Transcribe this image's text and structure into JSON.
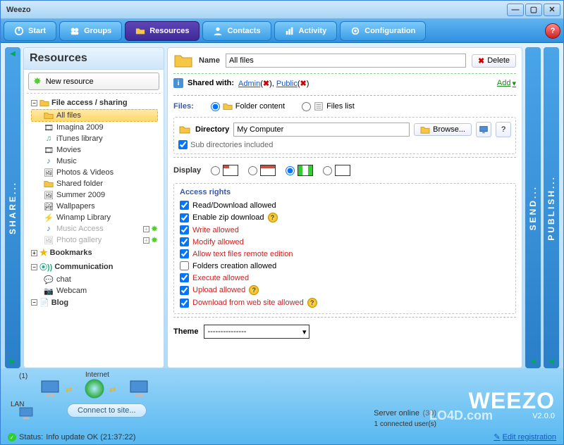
{
  "window": {
    "title": "Weezo"
  },
  "toolbar": {
    "tabs": [
      {
        "label": "Start",
        "icon": "power-icon"
      },
      {
        "label": "Groups",
        "icon": "groups-icon"
      },
      {
        "label": "Resources",
        "icon": "folder-icon",
        "active": true
      },
      {
        "label": "Contacts",
        "icon": "contacts-icon"
      },
      {
        "label": "Activity",
        "icon": "activity-icon"
      },
      {
        "label": "Configuration",
        "icon": "gear-icon"
      }
    ]
  },
  "side": {
    "left": "SHARE...",
    "right1": "SEND...",
    "right2": "PUBLISH..."
  },
  "left": {
    "header": "Resources",
    "new_btn": "New resource",
    "groups": {
      "file_sharing": {
        "label": "File access / sharing",
        "expanded": true,
        "items": [
          {
            "label": "All files",
            "icon": "folder-icon",
            "selected": true
          },
          {
            "label": "Imagina 2009",
            "icon": "film-icon"
          },
          {
            "label": "iTunes library",
            "icon": "itunes-icon"
          },
          {
            "label": "Movies",
            "icon": "film-icon"
          },
          {
            "label": "Music",
            "icon": "music-icon"
          },
          {
            "label": "Photos & Videos",
            "icon": "photo-icon"
          },
          {
            "label": "Shared folder",
            "icon": "folder-icon"
          },
          {
            "label": "Summer 2009",
            "icon": "photo-icon"
          },
          {
            "label": "Wallpapers",
            "icon": "picture-icon"
          },
          {
            "label": "Winamp Library",
            "icon": "winamp-icon"
          },
          {
            "label": "Music Access",
            "icon": "music-icon",
            "disabled": true,
            "extra": true
          },
          {
            "label": "Photo gallery",
            "icon": "photo-icon",
            "disabled": true,
            "extra": true
          }
        ]
      },
      "bookmarks": {
        "label": "Bookmarks",
        "expanded": false
      },
      "communication": {
        "label": "Communication",
        "expanded": true,
        "items": [
          {
            "label": "chat",
            "icon": "chat-icon"
          },
          {
            "label": "Webcam",
            "icon": "webcam-icon"
          }
        ]
      },
      "blog": {
        "label": "Blog",
        "expanded": true
      }
    }
  },
  "right": {
    "name_label": "Name",
    "name_value": "All files",
    "delete_label": "Delete",
    "shared_label": "Shared with:",
    "shared_users": [
      "Admin",
      "Public"
    ],
    "add_label": "Add",
    "files_label": "Files:",
    "folder_content_label": "Folder content",
    "files_list_label": "Files list",
    "files_mode": "folder_content",
    "directory_label": "Directory",
    "directory_value": "My Computer",
    "browse_label": "Browse...",
    "subdir_label": "Sub directories included",
    "subdir_checked": true,
    "display_label": "Display",
    "display_selected": 2,
    "access_title": "Access rights",
    "rights": [
      {
        "label": "Read/Download allowed",
        "checked": true,
        "red": false,
        "help": false
      },
      {
        "label": "Enable zip download",
        "checked": true,
        "red": false,
        "help": true
      },
      {
        "label": "Write allowed",
        "checked": true,
        "red": true,
        "help": false
      },
      {
        "label": "Modify allowed",
        "checked": true,
        "red": true,
        "help": false
      },
      {
        "label": "Allow text files remote edition",
        "checked": true,
        "red": true,
        "help": false
      },
      {
        "label": "Folders creation allowed",
        "checked": false,
        "red": false,
        "help": false
      },
      {
        "label": "Execute allowed",
        "checked": true,
        "red": true,
        "help": false
      },
      {
        "label": "Upload allowed",
        "checked": true,
        "red": true,
        "help": true
      },
      {
        "label": "Download from web site allowed",
        "checked": true,
        "red": true,
        "help": true
      }
    ],
    "theme_label": "Theme",
    "theme_value": "---------------"
  },
  "footer": {
    "internet_label": "Internet",
    "lan_label": "LAN",
    "connect_label": "Connect to site...",
    "brand": "WEEZO",
    "version": "V2.0.0",
    "server_status": "Server online",
    "server_count_suffix": "(30)",
    "connected_users": "1 connected user(s)",
    "edit_reg": "Edit registration",
    "status_prefix": "Status:",
    "status_text": "Info update OK (21:37:22)",
    "one_badge": "(1)"
  }
}
